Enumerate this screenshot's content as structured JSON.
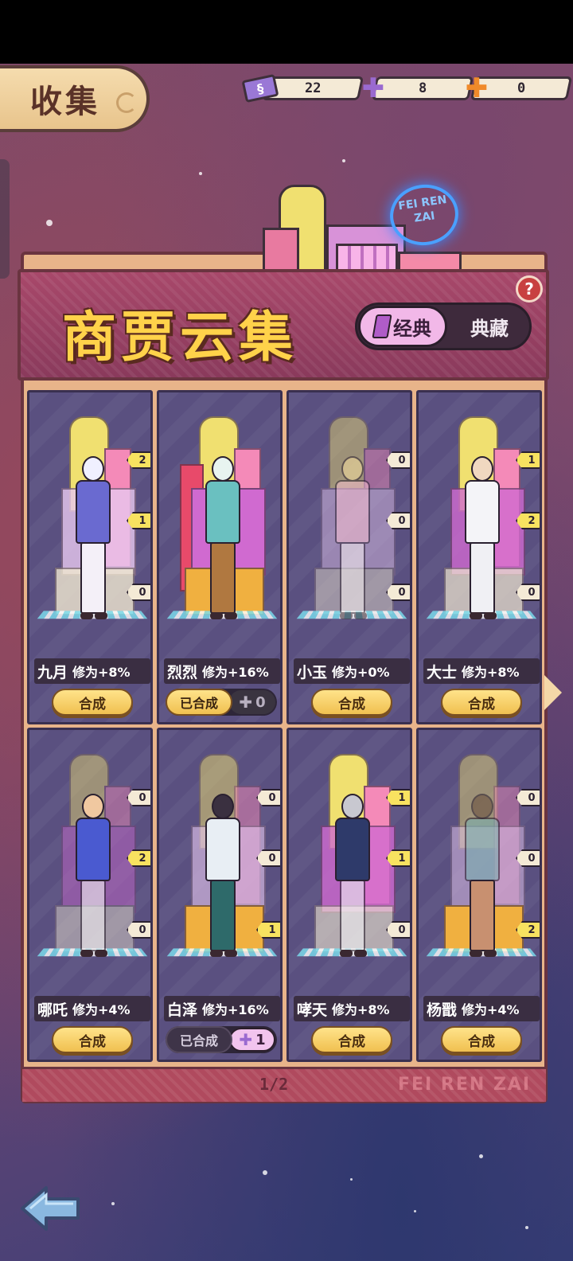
{
  "header": {
    "title": "收集"
  },
  "currencies": [
    {
      "icon": "ticket-icon",
      "value": "22"
    },
    {
      "icon": "purple-puzzle-icon",
      "value": "8"
    },
    {
      "icon": "orange-puzzle-icon",
      "value": "0"
    }
  ],
  "banner": {
    "title": "商贾云集",
    "neon_sign": "FEI REN ZAI",
    "tabs": {
      "classic": "经典",
      "collection": "典藏"
    },
    "help": "?"
  },
  "cards": [
    {
      "name": "九月",
      "bonus": "修为+8%",
      "badges": [
        "2",
        "1",
        "0"
      ],
      "action": "合成",
      "state": "synth"
    },
    {
      "name": "烈烈",
      "bonus": "修为+16%",
      "badges": [],
      "action": "已合成",
      "pieces": "0",
      "state": "done-yellow"
    },
    {
      "name": "小玉",
      "bonus": "修为+0%",
      "badges": [
        "0",
        "0",
        "0"
      ],
      "action": "合成",
      "state": "synth"
    },
    {
      "name": "大士",
      "bonus": "修为+8%",
      "badges": [
        "1",
        "2",
        "0"
      ],
      "action": "合成",
      "state": "synth"
    },
    {
      "name": "哪吒",
      "bonus": "修为+4%",
      "badges": [
        "0",
        "2",
        "0"
      ],
      "action": "合成",
      "state": "synth"
    },
    {
      "name": "白泽",
      "bonus": "修为+16%",
      "badges": [
        "0",
        "0",
        "1"
      ],
      "action": "已合成",
      "pieces": "1",
      "state": "done-dark"
    },
    {
      "name": "哮天",
      "bonus": "修为+8%",
      "badges": [
        "1",
        "1",
        "0"
      ],
      "action": "合成",
      "state": "synth"
    },
    {
      "name": "杨戬",
      "bonus": "修为+4%",
      "badges": [
        "0",
        "0",
        "2"
      ],
      "action": "合成",
      "state": "synth"
    }
  ],
  "pagination": {
    "label": "1/2"
  },
  "watermark": "FEI REN ZAI",
  "colors": {
    "accent_yellow": "#f8e260",
    "panel": "#e8b48a",
    "card_bg": "#5a5080"
  }
}
